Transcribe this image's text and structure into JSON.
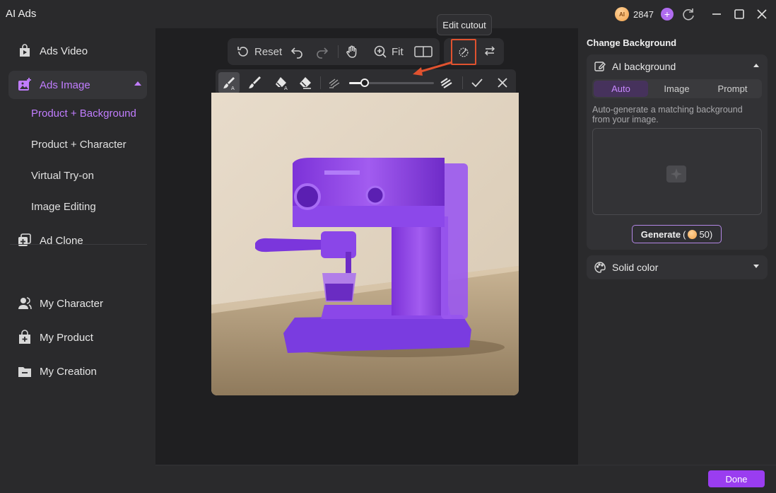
{
  "app": {
    "title": "AI Ads",
    "credits": "2847",
    "coin_label": "AI"
  },
  "sidebar": {
    "items": [
      {
        "label": "Ads Video",
        "icon": "video-bag-icon"
      },
      {
        "label": "Ads Image",
        "icon": "image-plus-icon",
        "expanded": true
      },
      {
        "label": "Ad Clone",
        "icon": "clone-icon"
      },
      {
        "label": "My Character",
        "icon": "users-icon"
      },
      {
        "label": "My Product",
        "icon": "product-bag-icon"
      },
      {
        "label": "My Creation",
        "icon": "folder-icon"
      }
    ],
    "sub_items": [
      {
        "label": "Product + Background",
        "active": true
      },
      {
        "label": "Product + Character"
      },
      {
        "label": "Virtual Try-on"
      },
      {
        "label": "Image Editing"
      }
    ]
  },
  "toolbar": {
    "reset_label": "Reset",
    "fit_label": "Fit",
    "tooltip": "Edit cutout"
  },
  "brush_toolbar": {
    "size_level": 0.18
  },
  "right_panel": {
    "title": "Change Background",
    "ai_background": {
      "label": "AI background",
      "tabs": [
        "Auto",
        "Image",
        "Prompt"
      ],
      "active_tab": "Auto",
      "description": "Auto-generate a matching background from your image.",
      "generate_label": "Generate",
      "generate_open": " (",
      "generate_cost": "50)"
    },
    "solid_color": {
      "label": "Solid color"
    }
  },
  "footer": {
    "done_label": "Done"
  },
  "colors": {
    "accent": "#c17dff",
    "done": "#9a3df0",
    "highlight": "#e0522f",
    "overlay": "#8a3cf0"
  }
}
